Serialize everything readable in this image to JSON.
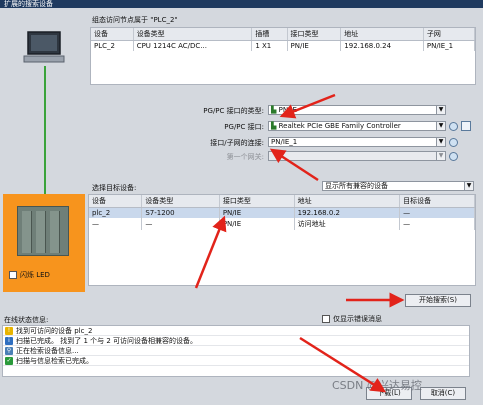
{
  "window": {
    "title": "扩展的搜索设备"
  },
  "target_device_section": {
    "title": "组态访问节点属于 \"PLC_2\"",
    "columns": [
      "设备",
      "设备类型",
      "插槽",
      "接口类型",
      "地址",
      "子网"
    ],
    "rows": [
      [
        "PLC_2",
        "CPU 1214C AC/DC...",
        "1 X1",
        "PN/IE",
        "192.168.0.24",
        "PN/IE_1"
      ]
    ]
  },
  "interface_settings": {
    "pgpc_type_label": "PG/PC 接口的类型:",
    "pgpc_type_value": "PN/IE",
    "pgpc_iface_label": "PG/PC 接口:",
    "pgpc_iface_value": "Realtek PCIe GBE Family Controller",
    "subnet_label": "接口/子网的连接:",
    "subnet_value": "PN/IE_1",
    "gateway_label": "第一个网关:",
    "gateway_value": ""
  },
  "select_target": {
    "title": "选择目标设备:",
    "filter_value": "显示所有兼容的设备",
    "columns": [
      "设备",
      "设备类型",
      "接口类型",
      "地址",
      "目标设备"
    ],
    "rows": [
      [
        "plc_2",
        "S7-1200",
        "PN/IE",
        "192.168.0.2",
        "—"
      ],
      [
        "—",
        "—",
        "PN/IE",
        "访问地址",
        "—"
      ]
    ]
  },
  "device_panel": {
    "flash_led_label": "闪烁 LED"
  },
  "start_search_label": "开始搜索(S)",
  "status": {
    "title": "在线状态信息:",
    "only_errors_label": "仅显示错误消息",
    "messages": [
      {
        "icon": "warning-icon",
        "text": "找到可访问的设备 plc_2"
      },
      {
        "icon": "info-icon",
        "text": "扫描已完成。 找到了 1 个与 2 可访问设备相兼容的设备。"
      },
      {
        "icon": "search-icon",
        "text": "正在检索设备信息..."
      },
      {
        "icon": "check-icon",
        "text": "扫描与信息检索已完成。"
      }
    ]
  },
  "buttons": {
    "load": "下载(L)",
    "cancel": "取消(C)"
  },
  "watermark": "CSDN @兴达易控",
  "colors": {
    "accent_orange": "#f7941d",
    "link_green": "#3aa33a",
    "arrow_red": "#e2231a",
    "selection_blue": "#c9d8ec"
  }
}
